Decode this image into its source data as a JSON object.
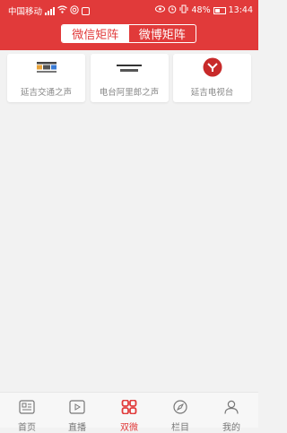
{
  "status_bar": {
    "carrier": "中国移动",
    "battery": "48%",
    "time": "13:44"
  },
  "segmented": {
    "tabs": [
      {
        "label": "微信矩阵",
        "active": true
      },
      {
        "label": "微博矩阵",
        "active": false
      }
    ]
  },
  "accounts": [
    {
      "label": "延吉交通之声",
      "icon": "traffic-radio-logo"
    },
    {
      "label": "电台阿里郎之声",
      "icon": "arirang-radio-logo"
    },
    {
      "label": "延吉电视台",
      "icon": "yanji-tv-logo"
    }
  ],
  "tabbar": {
    "items": [
      {
        "label": "首页",
        "icon": "news-icon"
      },
      {
        "label": "直播",
        "icon": "live-video-icon"
      },
      {
        "label": "双微",
        "icon": "grid-icon",
        "active": true
      },
      {
        "label": "栏目",
        "icon": "compass-icon"
      },
      {
        "label": "我的",
        "icon": "user-icon"
      }
    ]
  },
  "colors": {
    "brand": "#e13a3a",
    "inactive_text": "#777777",
    "background": "#f2f2f2"
  }
}
